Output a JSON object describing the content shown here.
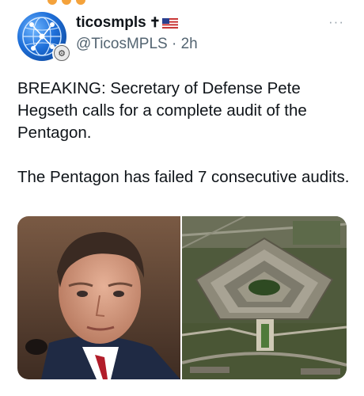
{
  "tweet": {
    "display_name": "ticosmpls",
    "name_emoji": "✝🇺🇸",
    "handle": "@TicosMPLS",
    "separator": "·",
    "time": "2h",
    "text_p1": "BREAKING: Secretary of Defense Pete Hegseth calls for a complete audit of the Pentagon.",
    "text_p2": "The Pentagon has failed 7 consecutive audits.",
    "more_icon": "···"
  },
  "icons": {
    "avatar": "globe-network-icon",
    "badge": "seal-icon",
    "more": "more-options-icon",
    "cross": "cross-icon",
    "flag": "us-flag-icon"
  },
  "colors": {
    "text_primary": "#0f1419",
    "text_secondary": "#536471",
    "avatar_blue": "#1e6fd9"
  }
}
